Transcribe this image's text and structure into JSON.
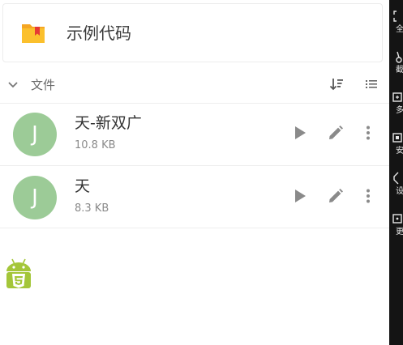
{
  "header": {
    "title": "示例代码",
    "icon": "folder-icon",
    "icon_color": "#f5a623"
  },
  "section": {
    "label": "文件",
    "expanded": true
  },
  "files": [
    {
      "avatar_letter": "J",
      "name": "天-新双广",
      "size": "10.8 KB"
    },
    {
      "avatar_letter": "J",
      "name": "天",
      "size": "8.3 KB"
    }
  ],
  "colors": {
    "avatar": "#9ccb97",
    "android_green": "#a4c639",
    "side_panel": "#141414"
  },
  "side_panel": {
    "items": [
      {
        "icon": "fullscreen-icon",
        "label": "全"
      },
      {
        "icon": "scissors-icon",
        "label": "截"
      },
      {
        "icon": "multi-window-icon",
        "label": "多"
      },
      {
        "icon": "security-icon",
        "label": "安"
      },
      {
        "icon": "settings-icon",
        "label": "设"
      },
      {
        "icon": "more-icon",
        "label": "更"
      }
    ]
  }
}
